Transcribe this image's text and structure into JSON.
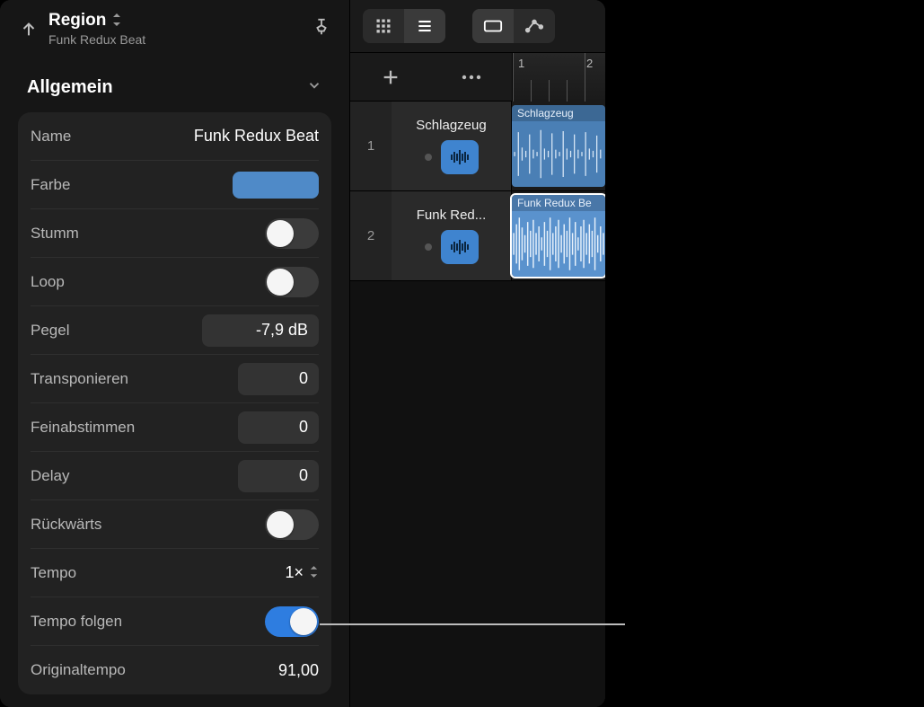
{
  "header": {
    "title": "Region",
    "subtitle": "Funk Redux Beat"
  },
  "section": {
    "title": "Allgemein"
  },
  "props": {
    "name_label": "Name",
    "name_value": "Funk Redux Beat",
    "color_label": "Farbe",
    "color_hex": "#4f8ac8",
    "mute_label": "Stumm",
    "mute_on": false,
    "loop_label": "Loop",
    "loop_on": false,
    "level_label": "Pegel",
    "level_value": "-7,9 dB",
    "transpose_label": "Transponieren",
    "transpose_value": "0",
    "finetune_label": "Feinabstimmen",
    "finetune_value": "0",
    "delay_label": "Delay",
    "delay_value": "0",
    "reverse_label": "Rückwärts",
    "reverse_on": false,
    "tempo_label": "Tempo",
    "tempo_value": "1×",
    "followtempo_label": "Tempo folgen",
    "followtempo_on": true,
    "origtempo_label": "Originaltempo",
    "origtempo_value": "91,00"
  },
  "ruler": {
    "bar1": "1",
    "bar2": "2"
  },
  "tracks": [
    {
      "num": "1",
      "name": "Schlagzeug",
      "region_label": "Schlagzeug",
      "selected": false
    },
    {
      "num": "2",
      "name": "Funk Red...",
      "region_label": "Funk Redux Be",
      "selected": true
    }
  ]
}
